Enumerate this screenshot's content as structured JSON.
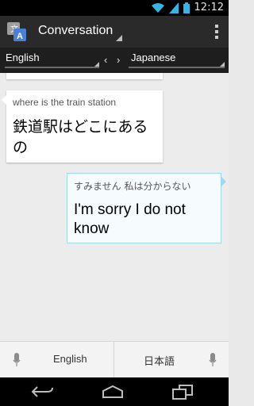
{
  "status_bar": {
    "time": "12:12",
    "icons": [
      "wifi-icon",
      "signal-icon",
      "battery-icon"
    ]
  },
  "action_bar": {
    "title": "Conversation",
    "app_icon": "translate-icon",
    "overflow_icon": "overflow-menu-icon"
  },
  "language_bar": {
    "source": "English",
    "target": "Japanese",
    "swap": "‹ ›"
  },
  "messages": [
    {
      "side": "left",
      "source": "where is the train station",
      "translation": "鉄道駅はどこにあるの"
    },
    {
      "side": "right",
      "source": "すみません 私は分からない",
      "translation": "I'm sorry I do not know"
    }
  ],
  "bottom_bar": {
    "left_label": "English",
    "right_label": "日本語",
    "mic_icon": "microphone-icon"
  },
  "nav_bar": {
    "back": "back-icon",
    "home": "home-icon",
    "recents": "recents-icon"
  },
  "colors": {
    "accent": "#33b5e5",
    "bubble_border": "#9fd9ef"
  }
}
